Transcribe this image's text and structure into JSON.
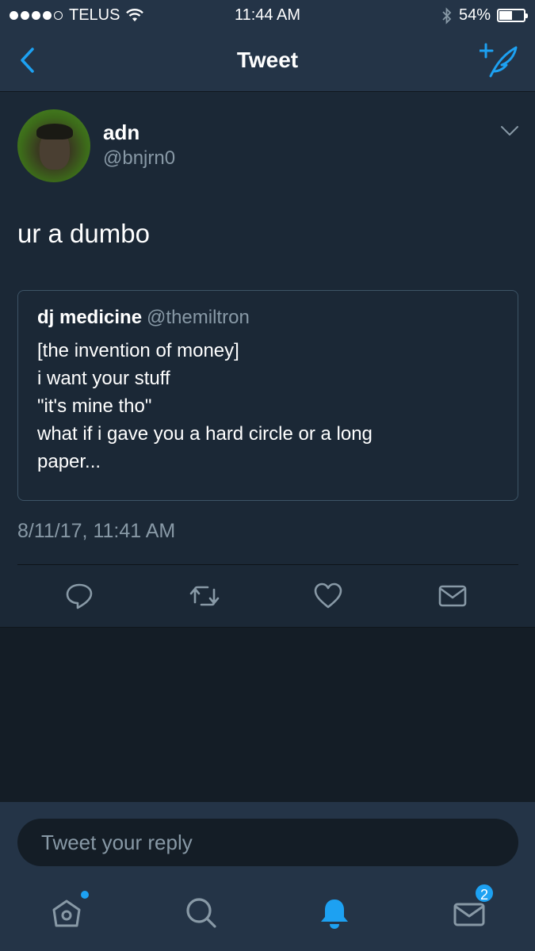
{
  "status_bar": {
    "carrier": "TELUS",
    "time": "11:44 AM",
    "battery": "54%",
    "battery_level": 0.54,
    "signal_dots_filled": 4,
    "icons": [
      "wifi-icon",
      "bluetooth-icon",
      "battery-icon"
    ]
  },
  "nav": {
    "title": "Tweet",
    "left_icon": "back-chevron-icon",
    "right_icon": "compose-tweet-icon"
  },
  "tweet": {
    "display_name": "adn",
    "handle": "@bnjrn0",
    "text": "ur a dumbo",
    "timestamp": "8/11/17, 11:41 AM",
    "quoted": {
      "display_name": "dj medicine",
      "handle": "@themiltron",
      "lines": [
        "[the invention of money]",
        "i want your stuff",
        "\"it's mine tho\"",
        "what if i gave you a hard circle or a long",
        "paper..."
      ]
    },
    "actions": [
      "reply-icon",
      "retweet-icon",
      "like-icon",
      "direct-message-icon"
    ]
  },
  "reply": {
    "placeholder": "Tweet your reply"
  },
  "tabbar": {
    "tabs": [
      "home-icon",
      "search-icon",
      "notifications-icon",
      "messages-icon"
    ],
    "messages_badge": "2"
  },
  "colors": {
    "accent": "#1da1f2",
    "background": "#141d26",
    "surface": "#1b2836",
    "bar": "#243447",
    "secondary_text": "#8899a6"
  }
}
